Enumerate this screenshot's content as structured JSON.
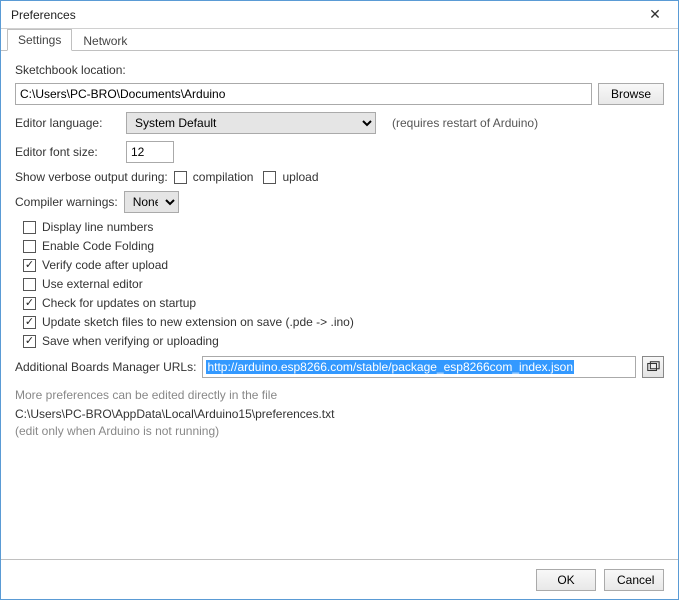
{
  "window": {
    "title": "Preferences"
  },
  "tabs": {
    "settings": "Settings",
    "network": "Network"
  },
  "sketchbook": {
    "label": "Sketchbook location:",
    "path": "C:\\Users\\PC-BRO\\Documents\\Arduino",
    "browse": "Browse"
  },
  "language": {
    "label": "Editor language:",
    "value": "System Default",
    "note": "(requires restart of Arduino)"
  },
  "fontsize": {
    "label": "Editor font size:",
    "value": "12"
  },
  "verbose": {
    "label": "Show verbose output during:",
    "compilation": "compilation",
    "upload": "upload"
  },
  "warnings": {
    "label": "Compiler warnings:",
    "value": "None"
  },
  "checks": {
    "line_numbers": "Display line numbers",
    "code_folding": "Enable Code Folding",
    "verify_upload": "Verify code after upload",
    "external_editor": "Use external editor",
    "check_updates": "Check for updates on startup",
    "update_ext": "Update sketch files to new extension on save (.pde -> .ino)",
    "save_verify": "Save when verifying or uploading"
  },
  "urls": {
    "label": "Additional Boards Manager URLs:",
    "value": "http://arduino.esp8266.com/stable/package_esp8266com_index.json"
  },
  "footer_notes": {
    "more": "More preferences can be edited directly in the file",
    "path": "C:\\Users\\PC-BRO\\AppData\\Local\\Arduino15\\preferences.txt",
    "edit_note": "(edit only when Arduino is not running)"
  },
  "buttons": {
    "ok": "OK",
    "cancel": "Cancel"
  }
}
